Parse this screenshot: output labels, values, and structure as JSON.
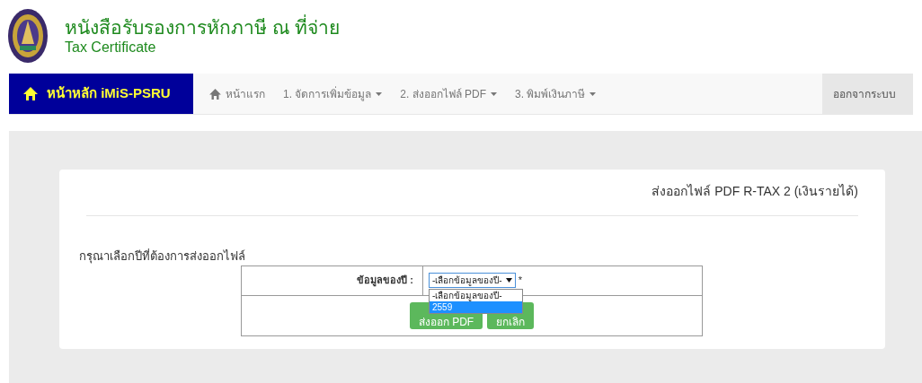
{
  "header": {
    "title": "หนังสือรับรองการหักภาษี ณ ที่จ่าย",
    "subtitle": "Tax Certificate"
  },
  "navbar": {
    "brand": "หน้าหลัก iMiS-PSRU",
    "items": [
      {
        "label": "หน้าแรก",
        "kind": "home"
      },
      {
        "label": "1. จัดการเพิ่มข้อมูล",
        "kind": "dropdown"
      },
      {
        "label": "2. ส่งออกไฟล์ PDF",
        "kind": "dropdown"
      },
      {
        "label": "3. พิมพ์เงินภาษี",
        "kind": "dropdown"
      }
    ],
    "logout": "ออกจากระบบ"
  },
  "panel": {
    "title": "ส่งออกไฟล์ PDF R-TAX 2 (เงินรายได้)",
    "prompt": "กรุณาเลือกปีที่ต้องการส่งออกไฟล์",
    "form": {
      "label": "ข้อมูลของปี :",
      "select_value": "-เลือกข้อมูลของปี-",
      "required_mark": "*",
      "options": [
        {
          "label": "-เลือกข้อมูลของปี-",
          "selected": false
        },
        {
          "label": "2559",
          "selected": true
        }
      ],
      "buttons": [
        "ส่งออก PDF",
        "ยกเลิก"
      ]
    }
  }
}
